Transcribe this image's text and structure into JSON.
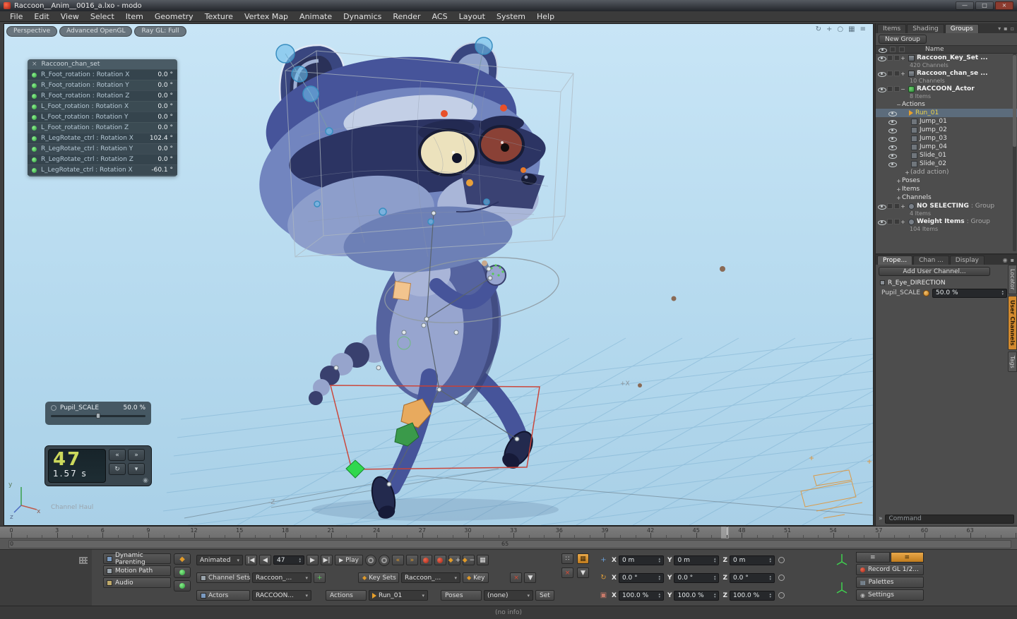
{
  "colors": {
    "viewport_bg": "#b9dcf0",
    "selection": "#5c6c7c",
    "action_selected_text": "#ecd24a",
    "autokey_orange": "#de942f",
    "record_red": "#c23a2a",
    "led_green": "#54d154",
    "active_side_tab": "#d28a2e"
  },
  "titlebar": {
    "title": "Raccoon__Anim__0016_a.lxo - modo"
  },
  "menubar": {
    "items": [
      "File",
      "Edit",
      "View",
      "Select",
      "Item",
      "Geometry",
      "Texture",
      "Vertex Map",
      "Animate",
      "Dynamics",
      "Render",
      "ACS",
      "Layout",
      "System",
      "Help"
    ]
  },
  "viewport": {
    "tabs": [
      "Perspective",
      "Advanced OpenGL",
      "Ray GL: Full"
    ],
    "overlay": {
      "title": "Raccoon_chan_set",
      "rows": [
        {
          "label": "R_Foot_rotation : Rotation X",
          "value": "0.0 °"
        },
        {
          "label": "R_Foot_rotation : Rotation Y",
          "value": "0.0 °"
        },
        {
          "label": "R_Foot_rotation : Rotation Z",
          "value": "0.0 °"
        },
        {
          "label": "L_Foot_rotation : Rotation X",
          "value": "0.0 °"
        },
        {
          "label": "L_Foot_rotation : Rotation Y",
          "value": "0.0 °"
        },
        {
          "label": "L_Foot_rotation : Rotation Z",
          "value": "0.0 °"
        },
        {
          "label": "R_LegRotate_ctrl : Rotation X",
          "value": "102.4 °"
        },
        {
          "label": "R_LegRotate_ctrl : Rotation Y",
          "value": "0.0 °"
        },
        {
          "label": "R_LegRotate_ctrl : Rotation Z",
          "value": "0.0 °"
        },
        {
          "label": "L_LegRotate_ctrl : Rotation X",
          "value": "-60.1 °"
        }
      ]
    },
    "pupil_slider": {
      "label": "Pupil_SCALE",
      "value": "50.0 %"
    },
    "frame_display": {
      "frame": "47",
      "time": "1.57 s"
    },
    "labels": {
      "plus_x": "+X",
      "minus_z": "-Z",
      "tool": "Channel Haul",
      "axis_x": "x",
      "axis_y": "y",
      "axis_z": "z"
    }
  },
  "groups_panel": {
    "tabs": [
      "Items",
      "Shading",
      "Groups"
    ],
    "new_group_label": "New Group",
    "name_column": "Name",
    "items": [
      {
        "label": "Raccoon_Key_Set ...",
        "sub": "420 Channels"
      },
      {
        "label": "Raccoon_chan_se ...",
        "sub": "10 Channels"
      },
      {
        "label": "RACCOON_Actor",
        "sub": "8 Items"
      }
    ],
    "actions_header": "Actions",
    "actions": [
      "Run_01",
      "Jump_01",
      "Jump_02",
      "Jump_03",
      "Jump_04",
      "Slide_01",
      "Slide_02"
    ],
    "add_action_label": "(add action)",
    "sections": [
      "Poses",
      "Items",
      "Channels"
    ],
    "groups": [
      {
        "label": "NO SELECTING",
        "suffix": ": Group",
        "sub": "4 Items"
      },
      {
        "label": "Weight Items",
        "suffix": ": Group",
        "sub": "104 Items"
      }
    ]
  },
  "properties_panel": {
    "tabs": [
      "Prope...",
      "Chan ...",
      "Display"
    ],
    "add_channel_label": "Add User Channel...",
    "section_label": "R_Eye_DIRECTION",
    "channel_label": "Pupil_SCALE",
    "channel_value": "50.0 %",
    "side_tabs": [
      "Locator",
      "User Channels",
      "Tags"
    ]
  },
  "command_bar": {
    "text": "Command"
  },
  "timeline": {
    "frame_min": 0,
    "frame_max": 66,
    "current_frame": 47,
    "labels": [
      "0",
      "3",
      "6",
      "9",
      "12",
      "15",
      "18",
      "21",
      "24",
      "27",
      "30",
      "33",
      "36",
      "39",
      "42",
      "45",
      "48",
      "51",
      "54",
      "57",
      "60",
      "63"
    ],
    "range_start": "0",
    "range_end": "65"
  },
  "toolbar": {
    "left_buttons": [
      "Dynamic Parenting",
      "Motion Path",
      "Audio"
    ],
    "mode_dropdown": "Animated",
    "frame_field": "47",
    "play_label": "Play",
    "channel_sets_label": "Channel Sets",
    "channel_sets_value": "Raccoon_...",
    "key_sets_label": "Key Sets",
    "key_sets_value": "Raccoon_...",
    "key_button": "Key",
    "actors_label": "Actors",
    "actors_value": "RACCOON...",
    "actions_label": "Actions",
    "actions_value": "Run_01",
    "poses_label": "Poses",
    "poses_value": "(none)",
    "set_button": "Set",
    "axes": [
      "X",
      "Y",
      "Z"
    ],
    "position": [
      "0 m",
      "0 m",
      "0 m"
    ],
    "rotation": [
      "0.0 °",
      "0.0 °",
      "0.0 °"
    ],
    "scale": [
      "100.0 %",
      "100.0 %",
      "100.0 %"
    ],
    "right_buttons": [
      "Record GL 1/2...",
      "Palettes",
      "Settings"
    ]
  },
  "statusbar": {
    "text": "(no info)"
  }
}
